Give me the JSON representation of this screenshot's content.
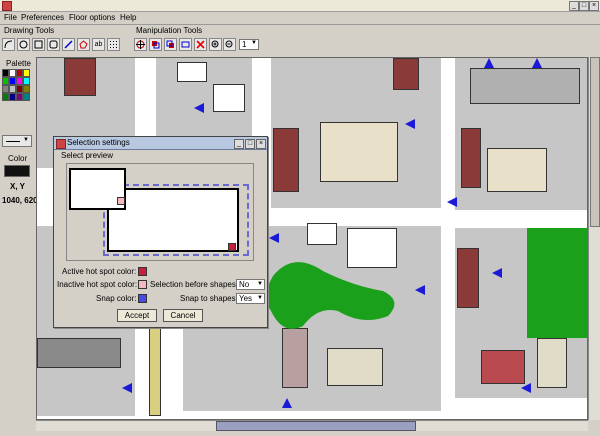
{
  "menu": [
    "File",
    "Preferences",
    "Floor options",
    "Help"
  ],
  "toolbar": {
    "drawing_label": "Drawing Tools",
    "manipulation_label": "Manipulation Tools",
    "zoom_level": "1"
  },
  "palette": {
    "label": "Palette",
    "colors": [
      "#000000",
      "#ffffff",
      "#c00000",
      "#ffff00",
      "#00c000",
      "#0000ff",
      "#ff00ff",
      "#00ffff",
      "#808080",
      "#c0c0c0",
      "#800000",
      "#808000",
      "#008000",
      "#000080",
      "#800080",
      "#008080"
    ]
  },
  "sidebar": {
    "color_label": "Color",
    "current_color": "#111111",
    "xy_label": "X, Y",
    "xy_value": "1040, 620"
  },
  "dialog": {
    "title": "Selection settings",
    "preview_label": "Select preview",
    "active_label": "Active hot spot color:",
    "active_color": "#c4223c",
    "inactive_label": "Inactive hot spot color:",
    "inactive_color": "#f4b8c0",
    "snap_color_label": "Snap color:",
    "snap_color": "#4a4ae0",
    "sel_before_label": "Selection before shapes:",
    "sel_before_value": "No",
    "snap_shapes_label": "Snap to shapes:",
    "snap_shapes_value": "Yes",
    "accept": "Accept",
    "cancel": "Cancel"
  }
}
